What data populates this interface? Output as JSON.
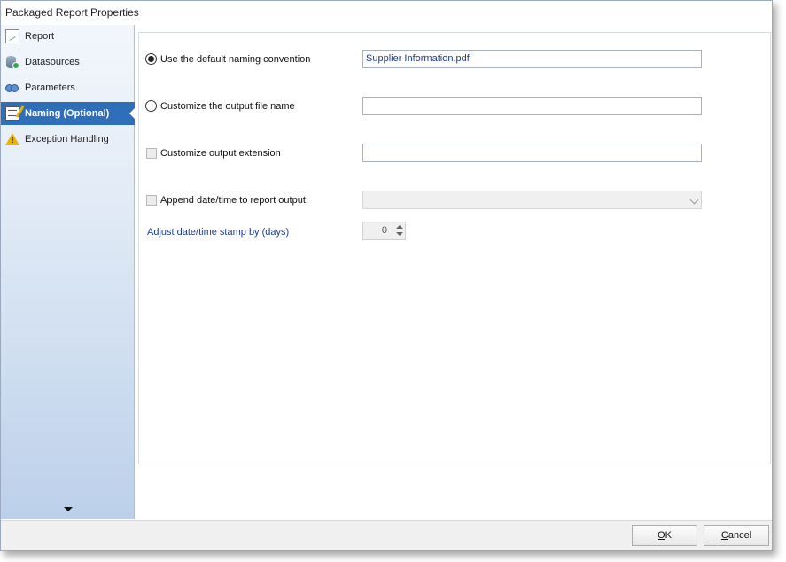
{
  "window": {
    "title": "Packaged Report Properties"
  },
  "sidebar": {
    "items": [
      {
        "label": "Report",
        "icon": "report-icon"
      },
      {
        "label": "Datasources",
        "icon": "datasource-icon"
      },
      {
        "label": "Parameters",
        "icon": "parameters-icon"
      },
      {
        "label": "Naming (Optional)",
        "icon": "naming-icon",
        "active": true
      },
      {
        "label": "Exception Handling",
        "icon": "warning-icon"
      }
    ]
  },
  "naming": {
    "default_label": "Use the default naming convention",
    "default_value": "Supplier Information.pdf",
    "custom_name_label": "Customize the output file name",
    "custom_name_value": "",
    "custom_ext_label": "Customize output extension",
    "custom_ext_value": "",
    "append_label": "Append date/time to report output",
    "append_value": "",
    "adjust_label": "Adjust date/time stamp by (days)",
    "adjust_value": "0"
  },
  "footer": {
    "ok_mnemonic": "O",
    "ok_rest": "K",
    "cancel_mnemonic": "C",
    "cancel_rest": "ancel"
  },
  "colors": {
    "accent": "#2f6fba",
    "link_text": "#1a3d8f"
  }
}
